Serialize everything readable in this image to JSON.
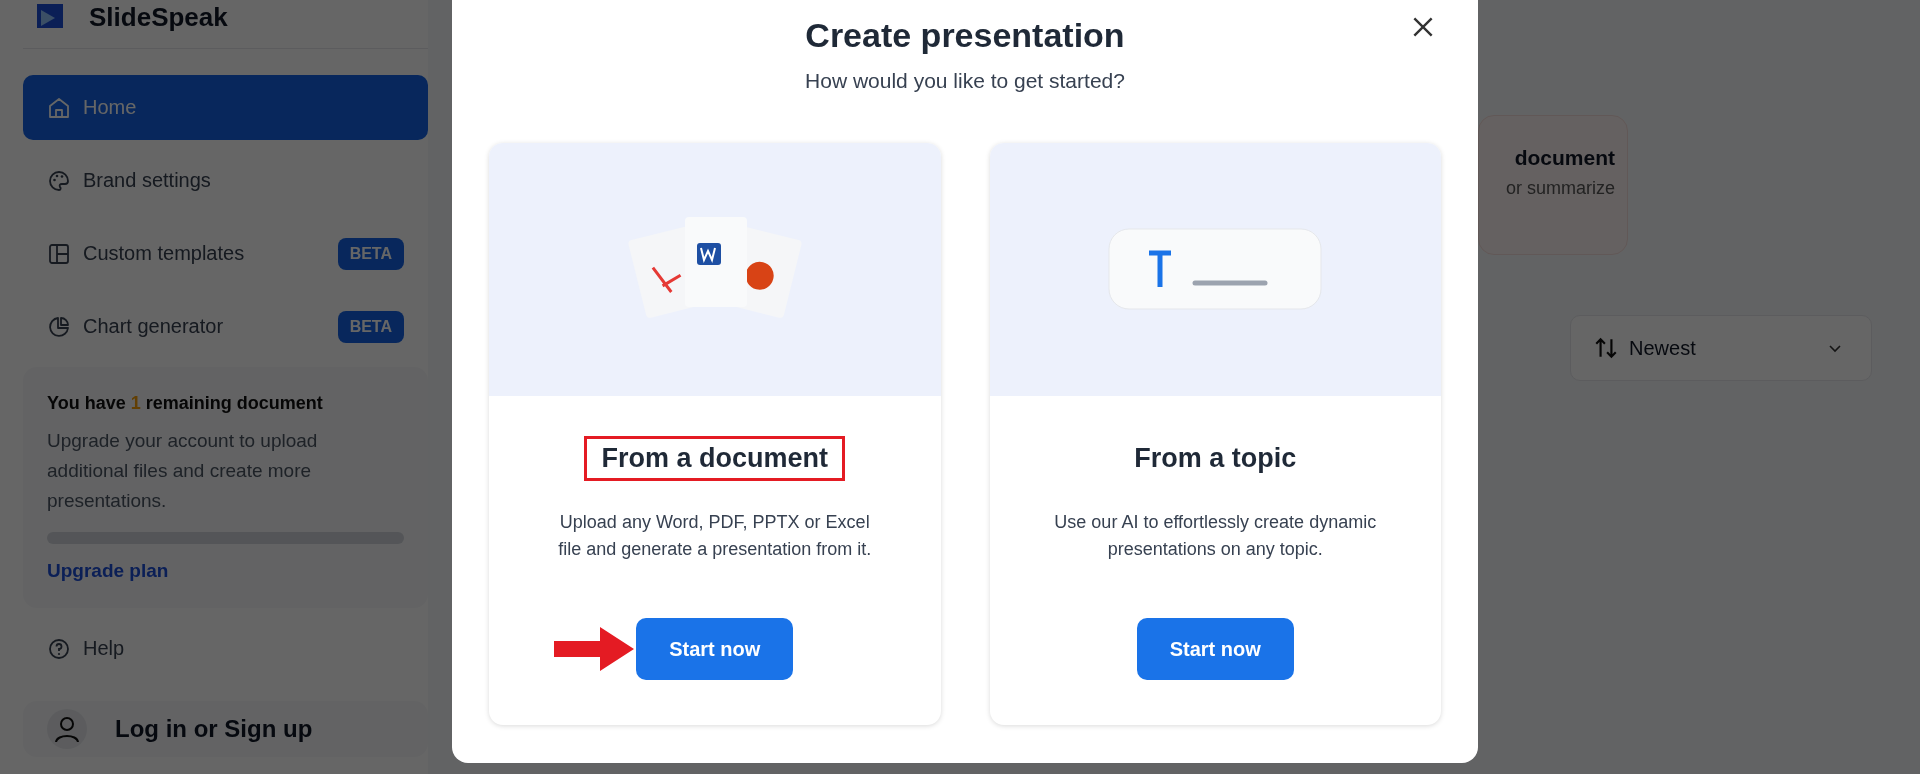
{
  "brand": {
    "name": "SlideSpeak"
  },
  "sidebar": {
    "items": [
      {
        "label": "Home",
        "kind": "home",
        "selected": true
      },
      {
        "label": "Brand settings",
        "kind": "brand",
        "selected": false
      },
      {
        "label": "Custom templates",
        "kind": "templates",
        "selected": false,
        "badge": "BETA"
      },
      {
        "label": "Chart generator",
        "kind": "charts",
        "selected": false,
        "badge": "BETA"
      }
    ],
    "quota": {
      "prefix": "You have ",
      "count": "1",
      "suffix": " remaining document",
      "description": "Upgrade your account to upload additional files and create more presentations.",
      "level": 0,
      "link": "Upgrade plan"
    },
    "help": "Help",
    "account": "Log in or Sign up"
  },
  "background": {
    "card_title": "document",
    "card_text": "or summarize",
    "sort": "Newest"
  },
  "modal": {
    "title": "Create presentation",
    "subtitle": "How would you like to get started?",
    "options": [
      {
        "kind": "document",
        "title": "From a document",
        "description": "Upload any Word, PDF, PPTX or Excel file and generate a presentation from it.",
        "button": "Start now",
        "highlighted": true
      },
      {
        "kind": "topic",
        "title": "From a topic",
        "description": "Use our AI to effortlessly create dynamic presentations on any topic.",
        "button": "Start now",
        "highlighted": false
      }
    ]
  }
}
